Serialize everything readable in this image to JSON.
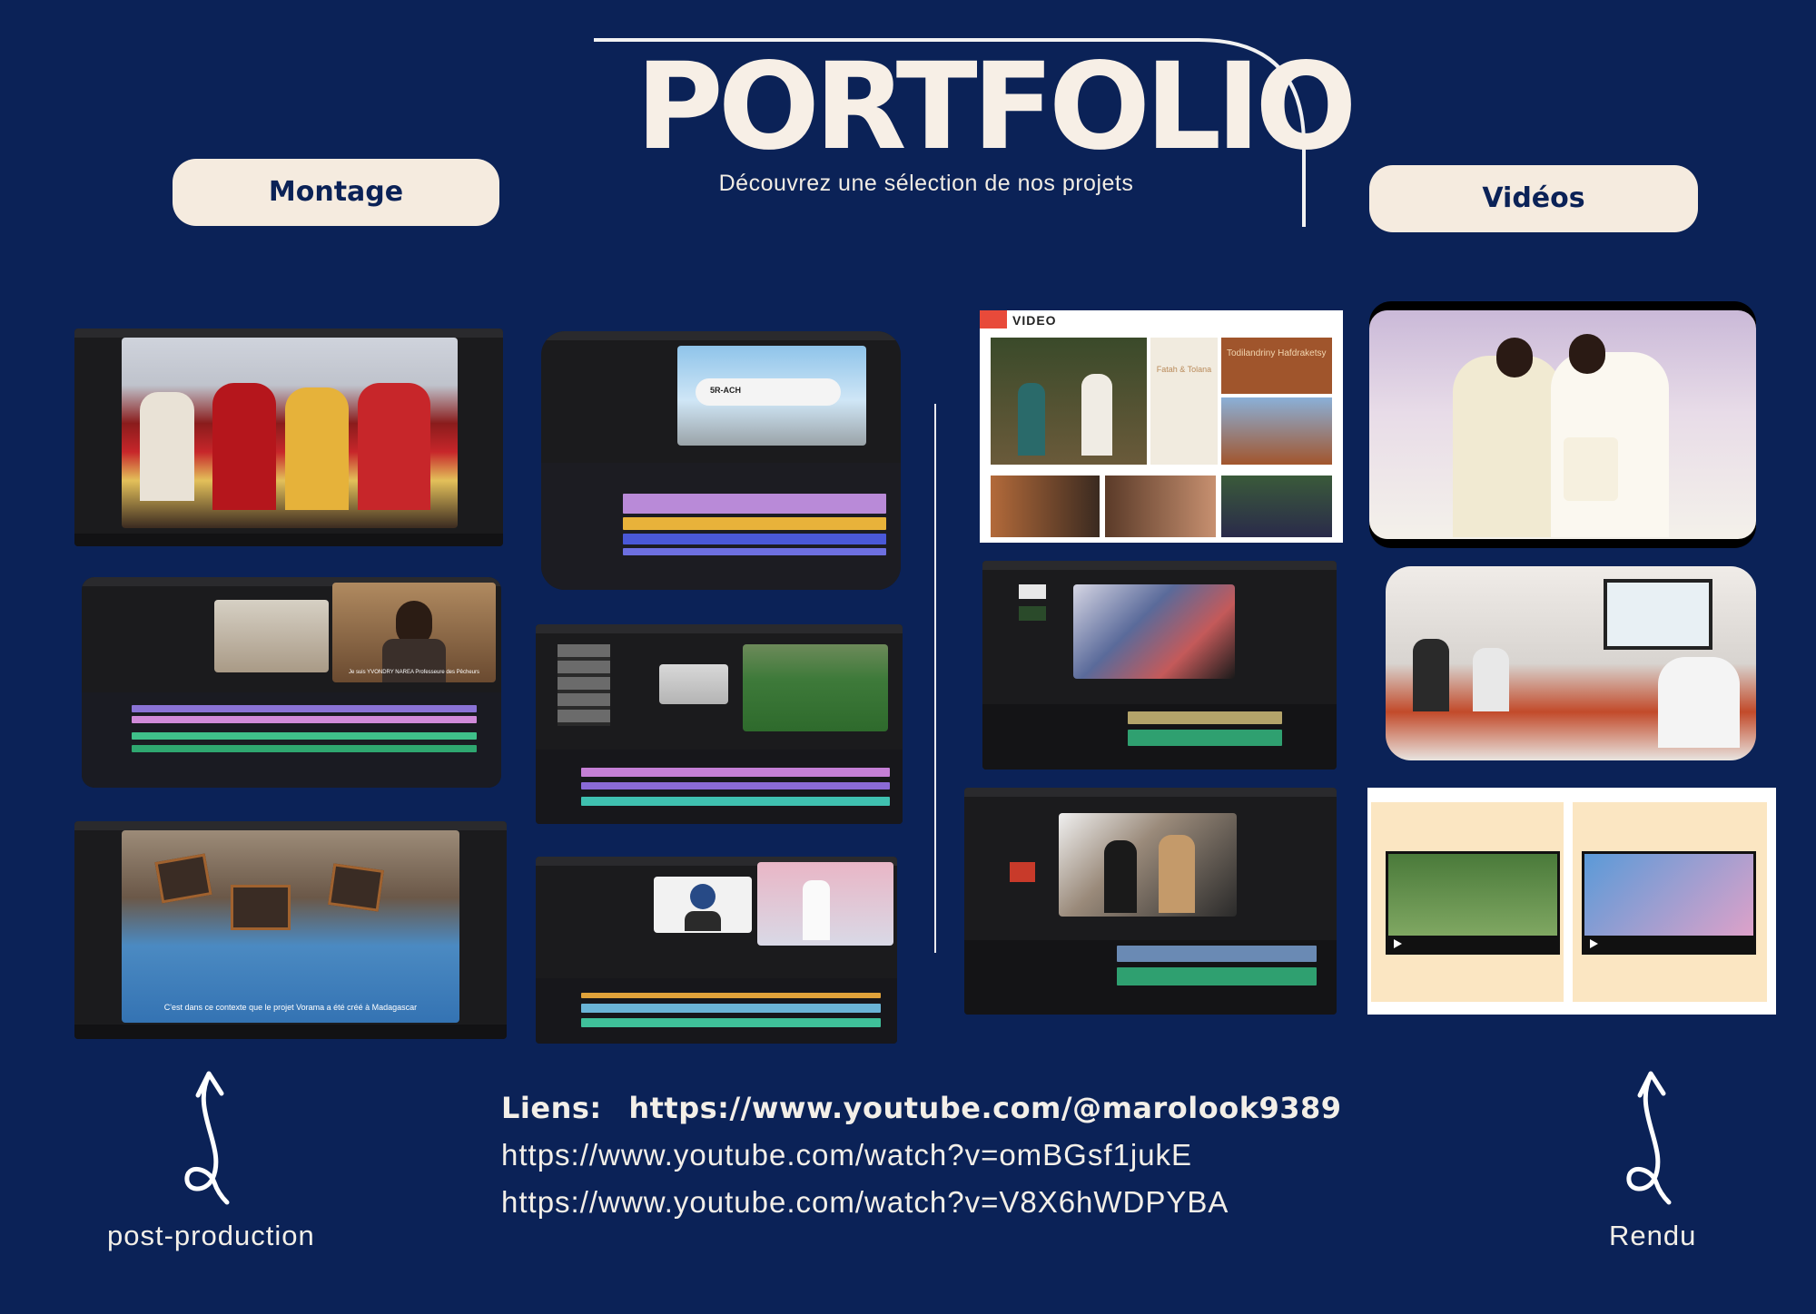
{
  "header": {
    "title": "PORTFOLIO",
    "subtitle": "Découvrez une sélection de nos projets"
  },
  "sections": {
    "left_label": "Montage",
    "right_label": "Vidéos"
  },
  "captions": {
    "left": "post-production",
    "right": "Rendu"
  },
  "links": {
    "label": "Liens:",
    "line1": "https://www.youtube.com/@marolook9389",
    "line2": "https://www.youtube.com/watch?v=omBGsf1jukE",
    "line3": "https://www.youtube.com/watch?v=V8X6hWDPYBA"
  },
  "thumbnails": {
    "video_card_badge": "VIDEO",
    "subtitle_left_2": "Je suis YVONDRY NAREA Professeure des Pêcheurs",
    "subtitle_left_3": "C'est dans ce contexte que le projet Vorama a été créé à Madagascar",
    "aircraft_reg": "5R-ACH",
    "sign_text": "Todilandriny Hafdraketsy",
    "card_names": "Fatah & Tolana"
  },
  "colors": {
    "background": "#0b2257",
    "pill": "#f5ebdf",
    "title": "#f7efe6"
  }
}
